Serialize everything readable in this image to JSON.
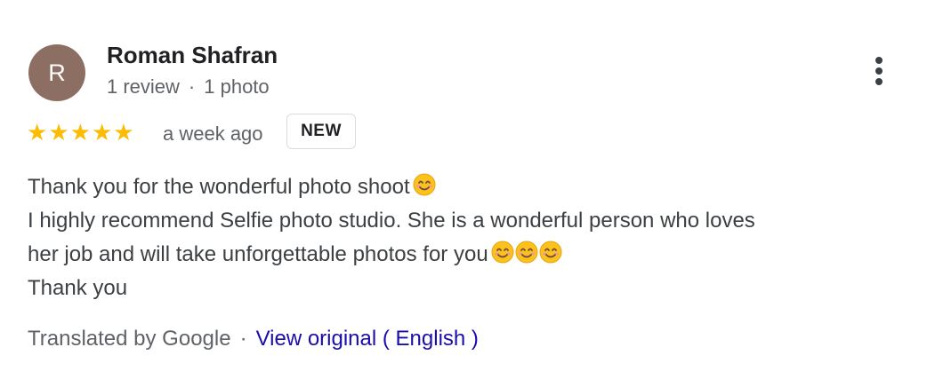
{
  "review": {
    "author": {
      "initial": "R",
      "name": "Roman Shafran",
      "reviews": "1 review",
      "separator": "·",
      "photos": "1 photo",
      "avatar_color": "#8d6e63"
    },
    "menu_icon": "more-vert-icon",
    "rating": {
      "stars": 5,
      "max_stars": 5,
      "star_icon": "star-icon",
      "star_color": "#fbbc04"
    },
    "date": "a week ago",
    "badge": "NEW",
    "text": {
      "line1": "Thank you for the wonderful photo shoot",
      "line2": "I highly recommend Selfie photo studio. She is a wonderful person who loves",
      "line3": "her job and will take unforgettable photos for you",
      "line4": "Thank you",
      "emoji_icon": "smiling-face-emoji"
    },
    "footer": {
      "translated_by": "Translated by Google",
      "separator": "·",
      "view_original": "View original ( English )",
      "link_color": "#1a0dab"
    }
  }
}
